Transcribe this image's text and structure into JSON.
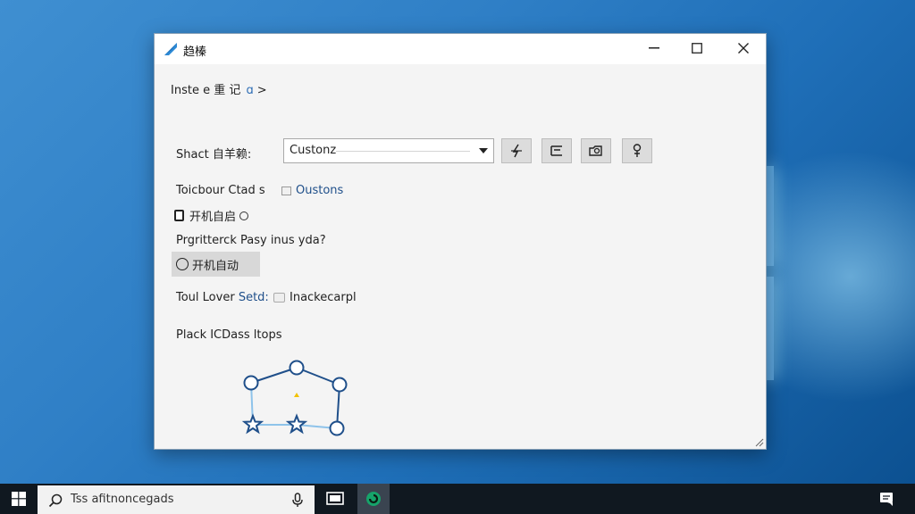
{
  "window": {
    "title": "趋榛",
    "controls": {
      "minimize": "minimize",
      "maximize": "maximize",
      "close": "close"
    }
  },
  "breadcrumb": {
    "text": "Inste e 重 记 ",
    "suffix": "ɑ",
    "chevron": ">"
  },
  "form": {
    "shortcut_label": "Shact 自羊赖:",
    "dropdown_value": "Custonz",
    "toolbar_icons": [
      "bolt-icon",
      "list-icon",
      "camera-icon",
      "pin-icon"
    ],
    "touch_label": "Toicbour Ctad s",
    "touch_value": "Oustons",
    "checkbox_label": "开机自启",
    "prompt_label": "Prgritterck Pasy inus yda?",
    "radio_label": "开机自动",
    "tool_label": "Toul Lover",
    "tool_label_accent": "Setd:",
    "tool_value": "Inackecarpl",
    "place_label": "Plack ICDass ltops"
  },
  "taskbar": {
    "search_placeholder": "Tss afitnoncegads"
  },
  "colors": {
    "accent": "#2d6db5",
    "graph_dark": "#1f4f8a",
    "graph_light": "#8ec3ea",
    "marker": "#f2c200"
  }
}
